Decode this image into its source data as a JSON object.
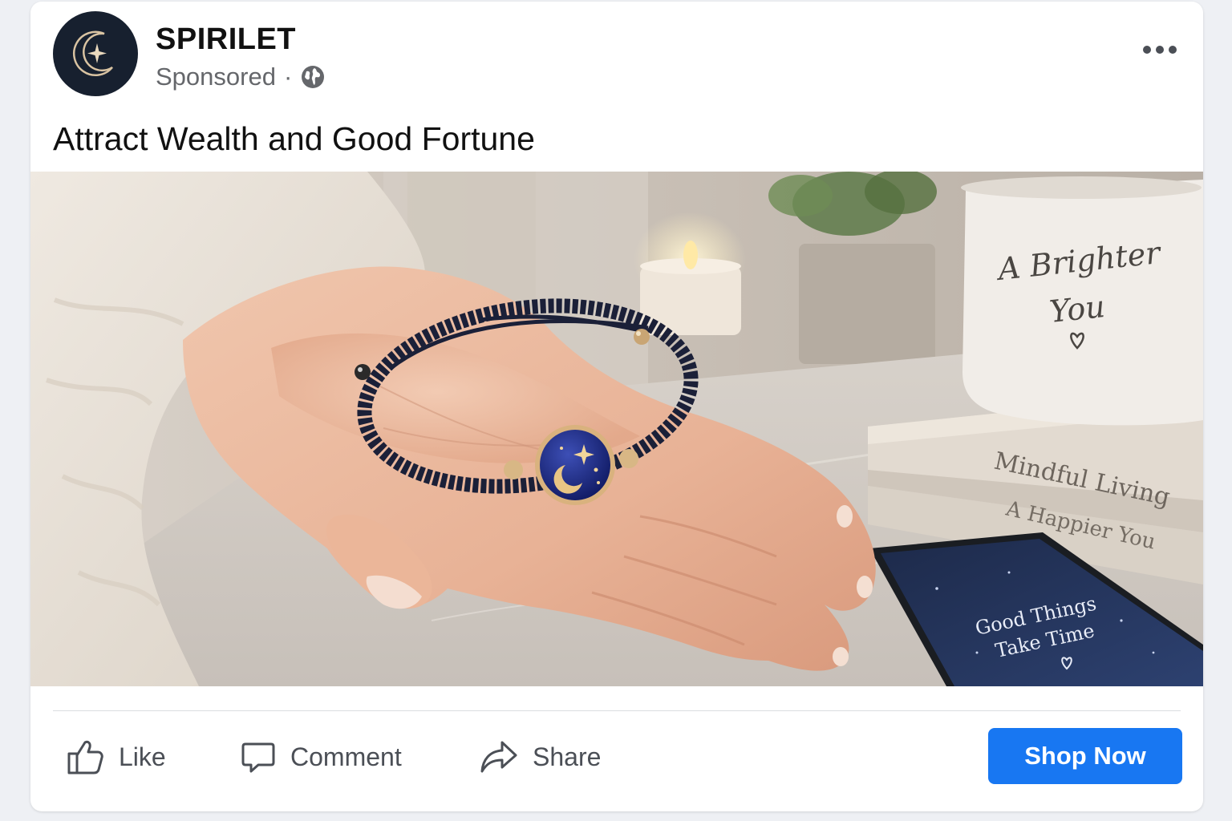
{
  "post": {
    "brand_name": "SPIRILET",
    "sponsored_label": "Sponsored",
    "meta_separator": "·",
    "headline": "Attract Wealth and Good Fortune",
    "more_options_icon": "more-dots-icon",
    "audience_icon": "globe-icon"
  },
  "image": {
    "mug_text_line1": "A Brighter",
    "mug_text_line2": "You",
    "book_top_title": "Mindful Living",
    "book_bottom_title": "A Happier You",
    "phone_text_line1": "Good Things",
    "phone_text_line2": "Take Time"
  },
  "actions": {
    "like_label": "Like",
    "comment_label": "Comment",
    "share_label": "Share",
    "cta_label": "Shop Now"
  },
  "colors": {
    "cta": "#1877f2",
    "brand_avatar_bg": "#17202f",
    "secondary_text": "#65676b"
  }
}
